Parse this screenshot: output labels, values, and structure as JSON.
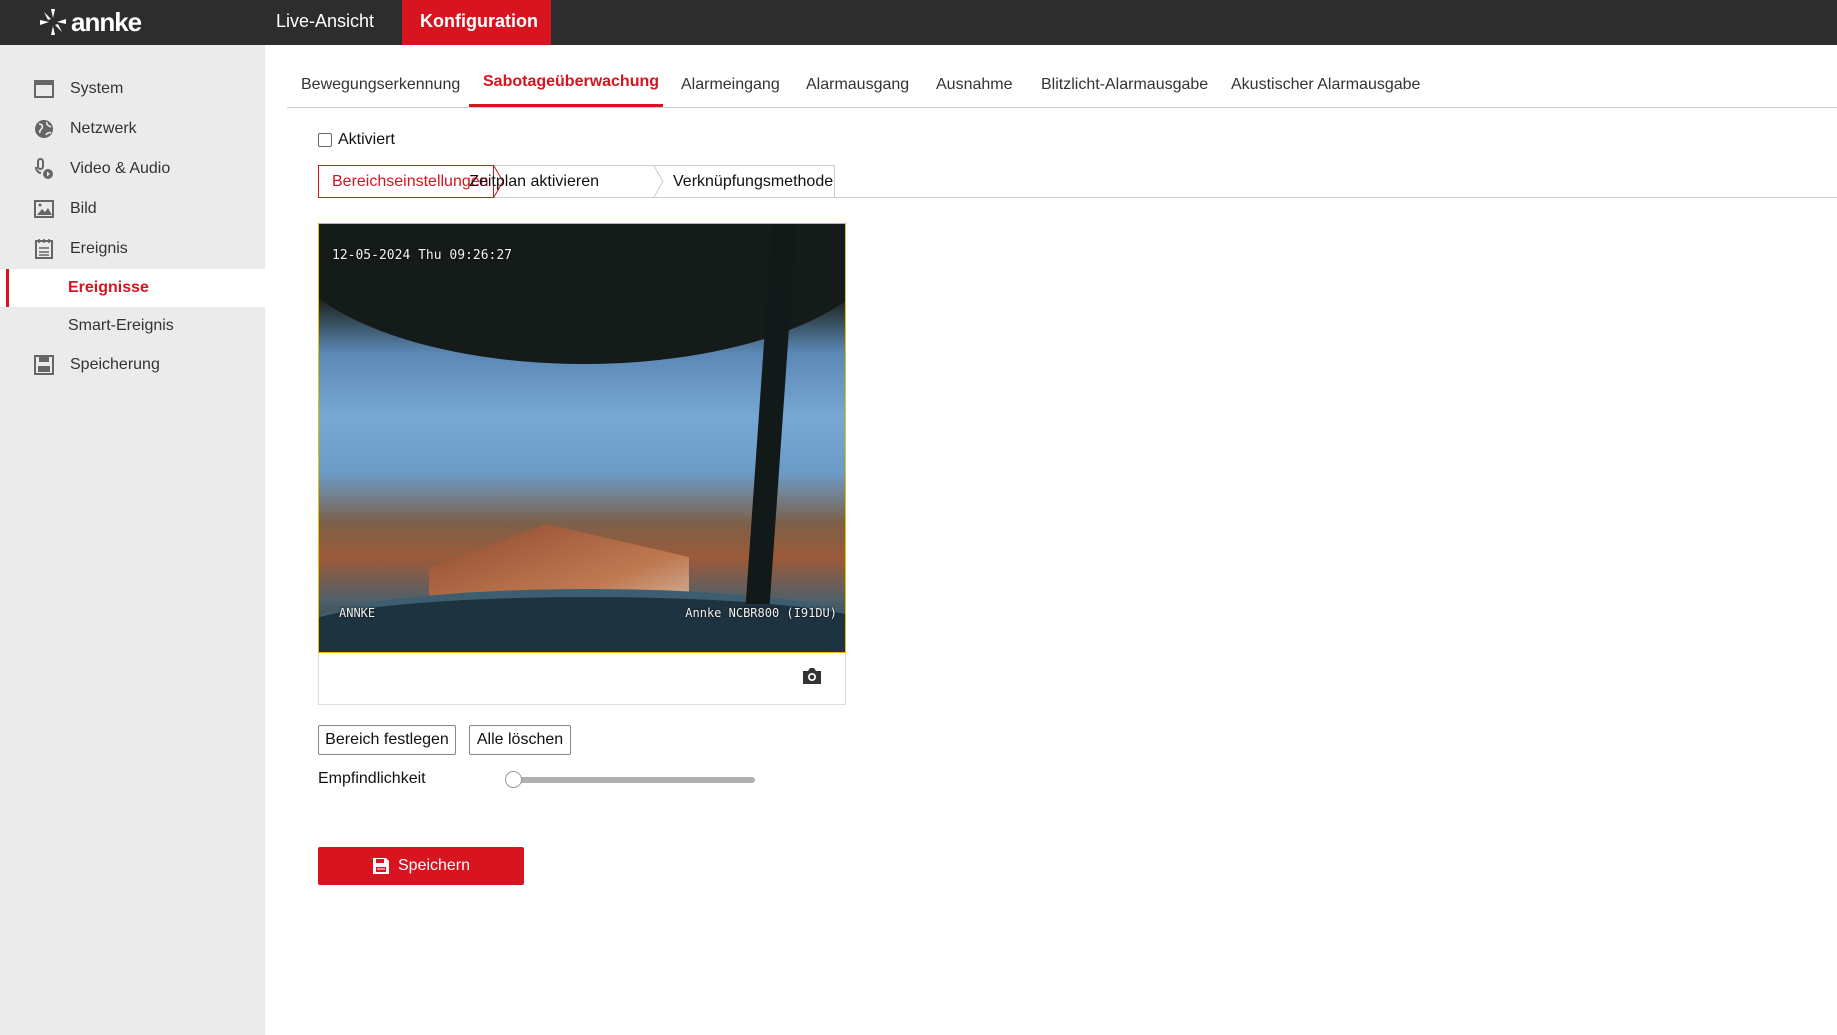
{
  "header": {
    "logo": "annke",
    "nav": [
      {
        "label": "Live-Ansicht"
      },
      {
        "label": "Konfiguration",
        "active": true
      }
    ]
  },
  "sidebar": {
    "items": [
      {
        "label": "System",
        "icon": "window-icon"
      },
      {
        "label": "Netzwerk",
        "icon": "globe-icon"
      },
      {
        "label": "Video & Audio",
        "icon": "microphone-icon"
      },
      {
        "label": "Bild",
        "icon": "image-icon"
      },
      {
        "label": "Ereignis",
        "icon": "calendar-icon"
      },
      {
        "label": "Ereignisse",
        "active": true
      },
      {
        "label": "Smart-Ereignis"
      },
      {
        "label": "Speicherung",
        "icon": "floppy-icon"
      }
    ]
  },
  "tabs": [
    "Bewegungserkennung",
    "Sabotageüberwachung",
    "Alarmeingang",
    "Alarmausgang",
    "Ausnahme",
    "Blitzlicht-Alarmausgabe",
    "Akustischer Alarmausgabe"
  ],
  "active_tab": "Sabotageüberwachung",
  "enabled": {
    "label": "Aktiviert",
    "checked": false
  },
  "steps": [
    "Bereichseinstellungen",
    "Zeitplan aktivieren",
    "Verknüpfungsmethode"
  ],
  "video": {
    "timestamp": "12-05-2024 Thu 09:26:27",
    "brand_overlay": "ANNKE",
    "model_overlay": "Annke NCBR800 (I91DU)"
  },
  "buttons": {
    "set_area": "Bereich festlegen",
    "clear_all": "Alle löschen",
    "save": "Speichern"
  },
  "sensitivity": {
    "label": "Empfindlichkeit",
    "value": 0
  },
  "colors": {
    "accent": "#d7141f",
    "header": "#2d2d2d",
    "sidebar": "#ebebeb"
  }
}
